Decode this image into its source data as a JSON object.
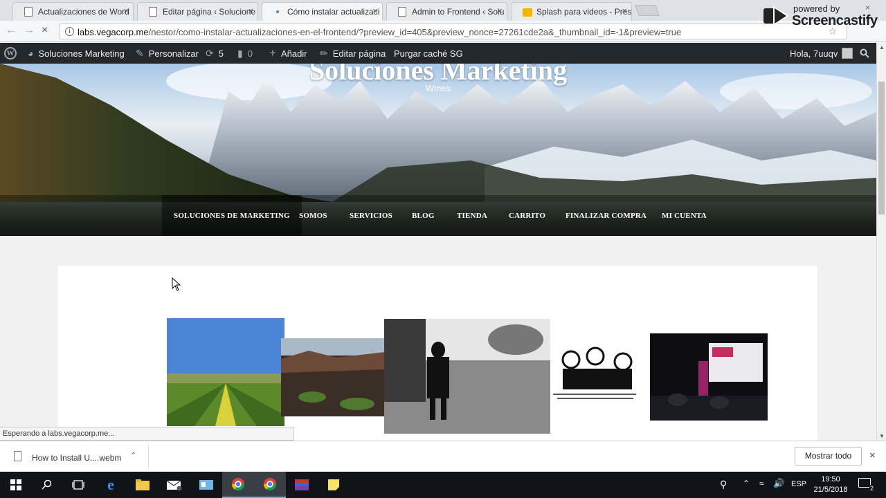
{
  "browser": {
    "tabs": [
      {
        "title": "Actualizaciones de Word",
        "icon": "page-icon",
        "active": false
      },
      {
        "title": "Editar página ‹ Solucione",
        "icon": "page-icon",
        "active": false
      },
      {
        "title": "Cómo instalar actualizaci",
        "icon": "loading-spinner-icon",
        "active": true
      },
      {
        "title": "Admin to Frontend ‹ Solu",
        "icon": "page-icon",
        "active": false
      },
      {
        "title": "Splash para videos - Pres",
        "icon": "slides-icon",
        "active": false
      }
    ],
    "close_glyph": "×",
    "url_host": "labs.vegacorp.me",
    "url_path": "/nestor/como-instalar-actualizaciones-en-el-frontend/?preview_id=405&preview_nonce=27261cde2a&_thumbnail_id=-1&preview=true",
    "status": "Esperando a labs.vegacorp.me..."
  },
  "watermark": {
    "powered": "powered by",
    "name": "Screencastify"
  },
  "adminbar": {
    "site_name": "Soluciones Marketing",
    "customize": "Personalizar",
    "updates_count": "5",
    "comments_count": "0",
    "add_new": "Añadir",
    "edit_page": "Editar página",
    "purge_cache": "Purgar caché SG",
    "greeting": "Hola, 7uuqv"
  },
  "site": {
    "title": "Soluciones Marketing",
    "description": "Wines",
    "menu": [
      "SOLUCIONES DE MARKETING",
      "SOMOS",
      "SERVICIOS",
      "BLOG",
      "TIENDA",
      "CARRITO",
      "FINALIZAR COMPRA",
      "MI CUENTA"
    ]
  },
  "downloads": {
    "file_name": "How to Install U....webm",
    "show_all": "Mostrar todo"
  },
  "taskbar": {
    "language": "ESP",
    "time": "19:50",
    "date": "21/5/2018",
    "notification_count": "2"
  },
  "colors": {
    "adminbar_bg": "#23282d",
    "content_bg": "#ffffff",
    "page_bg": "#f1f1f1",
    "taskbar_bg": "#101317"
  }
}
